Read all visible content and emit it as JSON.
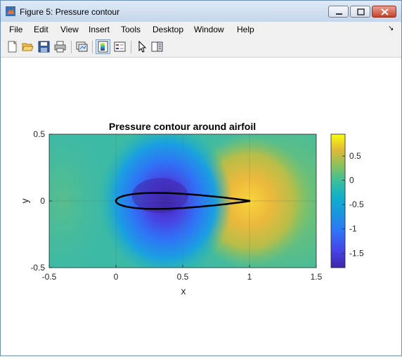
{
  "window": {
    "title": "Figure 5: Pressure contour"
  },
  "menu": {
    "items": [
      "File",
      "Edit",
      "View",
      "Insert",
      "Tools",
      "Desktop",
      "Window",
      "Help"
    ],
    "overflow_arrow": "↘"
  },
  "toolbar": {
    "icons": [
      "new-figure-icon",
      "open-file-icon",
      "save-icon",
      "print-icon",
      "link-plot-icon",
      "colorbar-icon",
      "legend-icon",
      "pointer-icon",
      "property-editor-icon"
    ]
  },
  "chart_data": {
    "type": "heatmap",
    "title": "Pressure contour around airfoil",
    "xlabel": "x",
    "ylabel": "y",
    "xlim": [
      -0.5,
      1.5
    ],
    "ylim": [
      -0.5,
      0.5
    ],
    "xticks": [
      "-0.5",
      "0",
      "0.5",
      "1",
      "1.5"
    ],
    "yticks": [
      "0.5",
      "0",
      "-0.5"
    ],
    "grid": true,
    "colormap": "parula",
    "colorbar": {
      "range": [
        -1.8,
        0.95
      ],
      "ticks": [
        "0.5",
        "0",
        "-0.5",
        "-1",
        "-1.5"
      ],
      "tick_values": [
        0.5,
        0,
        -0.5,
        -1,
        -1.5
      ]
    },
    "airfoil": {
      "leading_edge": [
        0,
        0
      ],
      "trailing_edge": [
        1,
        0
      ],
      "max_thickness": 0.12,
      "outline_color": "#000000"
    }
  }
}
